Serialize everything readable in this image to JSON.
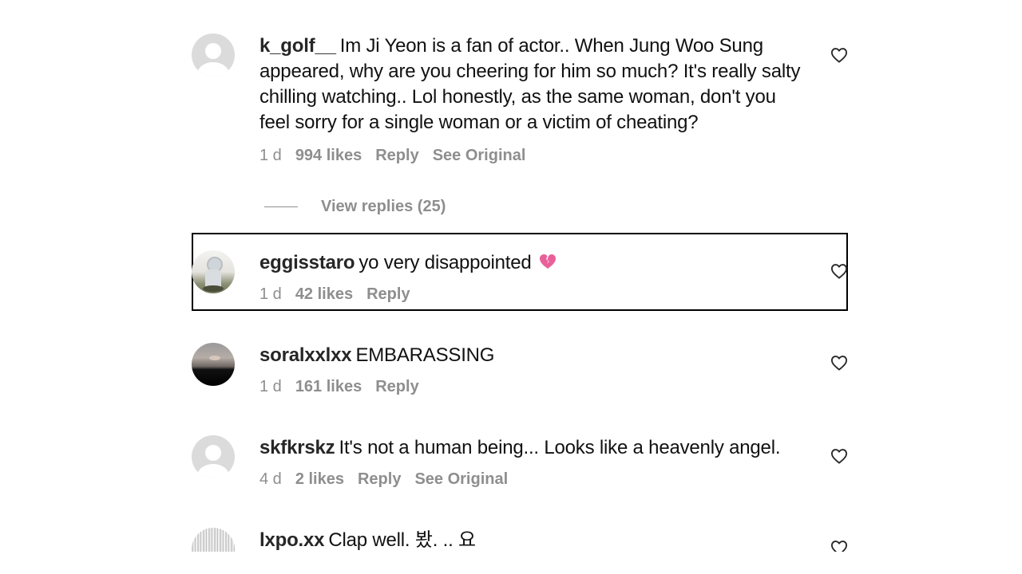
{
  "comments": [
    {
      "username": "k_golf__",
      "text": "Im Ji Yeon is a fan of actor.. When Jung Woo Sung appeared, why are you cheering for him so much? It's really salty chilling watching.. Lol honestly, as the same woman, don't you feel sorry for a single woman or a victim of cheating?",
      "age": "1 d",
      "likes": "994 likes",
      "reply": "Reply",
      "original": "See Original",
      "avatar": "default-avatar"
    },
    {
      "username": "eggisstaro",
      "text": "yo very disappointed",
      "emoji": "broken-heart-icon",
      "age": "1 d",
      "likes": "42 likes",
      "reply": "Reply",
      "avatar": "photo-avatar"
    },
    {
      "username": "soralxxlxx",
      "text": "EMBARASSING",
      "age": "1 d",
      "likes": "161 likes",
      "reply": "Reply",
      "avatar": "sunset-avatar"
    },
    {
      "username": "skfkrskz",
      "text": "It's not a human being... Looks like a heavenly angel.",
      "age": "4 d",
      "likes": "2 likes",
      "reply": "Reply",
      "original": "See Original",
      "avatar": "default-avatar"
    },
    {
      "username": "lxpo.xx",
      "text": "Clap well. 봤. .. 요",
      "avatar": "speckle-avatar"
    }
  ],
  "view_replies": "View replies (25)",
  "colors": {
    "username": "#262626",
    "meta": "#8e8e8e",
    "broken_heart": "#e8609a"
  }
}
